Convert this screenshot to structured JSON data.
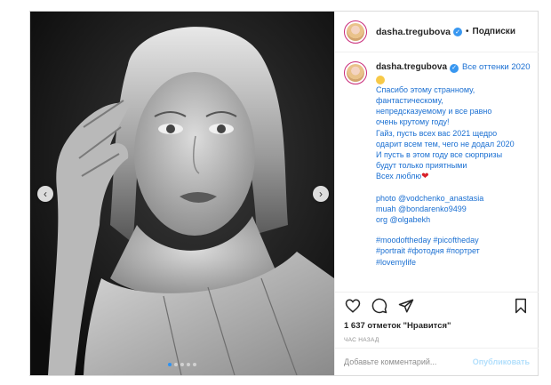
{
  "post": {
    "username": "dasha.tregubova",
    "separator": "•",
    "follow_label": "Подписки",
    "caption": {
      "title": "Все оттенки 2020",
      "lines": [
        "Спасибо этому странному,",
        "фантастическому,",
        "непредсказуемому и все равно",
        "очень крутому году!",
        "Гайз, пусть всех вас 2021 щедро",
        "одарит всем тем, чего не додал 2020",
        "И пусть в этом году все сюрпризы",
        "будут только приятными",
        "Всех люблю"
      ],
      "credits": [
        "photo @vodchenko_anastasia",
        "muah @bondarenko9499",
        "org @olgabekh"
      ],
      "hashtags": [
        "#moodoftheday #picoftheday",
        "#portrait #фотодня #портрет",
        "#lovemylife"
      ]
    },
    "likes_text": "1 637 отметок \"Нравится\"",
    "time_text": "ЧАС НАЗАД",
    "comment_placeholder": "Добавьте комментарий...",
    "publish_label": "Опубликовать",
    "carousel": {
      "active_index": 0,
      "total": 5
    }
  },
  "icons": {
    "prev": "chevron-left-icon",
    "next": "chevron-right-icon",
    "like": "heart-icon",
    "comment": "comment-icon",
    "share": "share-icon",
    "save": "bookmark-icon",
    "verified": "verified-badge-icon"
  },
  "colors": {
    "link": "#1a6fd2",
    "border": "#dbdbdb",
    "active_dot": "#2b93f5",
    "publish_disabled": "#b2dffc"
  }
}
